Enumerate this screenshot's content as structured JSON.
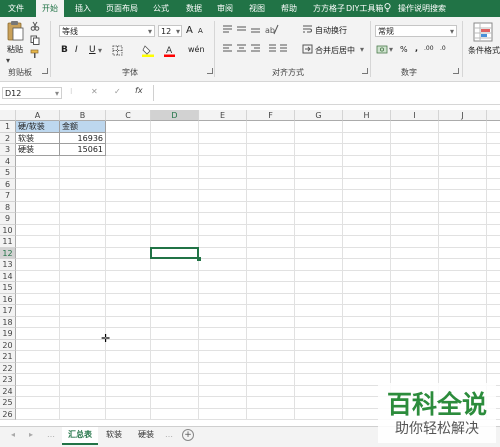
{
  "ribbon_tabs": [
    "文件",
    "开始",
    "插入",
    "页面布局",
    "公式",
    "数据",
    "审阅",
    "视图",
    "帮助",
    "方方格子",
    "DIY工具箱",
    "操作说明搜索"
  ],
  "active_tab": "开始",
  "clipboard": {
    "paste_label": "粘贴",
    "group_label": "剪贴板"
  },
  "font": {
    "name": "等线",
    "size": "12",
    "group_label": "字体",
    "grow_label": "A",
    "shrink_label": "A",
    "bold": "B",
    "italic": "I",
    "underline": "U",
    "wen": "wén"
  },
  "alignment": {
    "wrap_label": "自动换行",
    "merge_label": "合并后居中",
    "group_label": "对齐方式"
  },
  "number": {
    "format": "常规",
    "percent": "%",
    "comma": ",",
    "group_label": "数字",
    "dec_inc": ".00",
    "dec_dec": ".0"
  },
  "styles": {
    "cond_label": "条件格式"
  },
  "formula_bar": {
    "name_box": "D12",
    "fx": "fx",
    "formula": ""
  },
  "columns": [
    "A",
    "B",
    "C",
    "D",
    "E",
    "F",
    "G",
    "H",
    "I",
    "J",
    "K"
  ],
  "rows": [
    "1",
    "2",
    "3",
    "4",
    "5",
    "6",
    "7",
    "8",
    "9",
    "10",
    "11",
    "12",
    "13",
    "14",
    "15",
    "16",
    "17",
    "18",
    "19",
    "20",
    "21",
    "22",
    "23",
    "24",
    "25",
    "26"
  ],
  "cells": {
    "A1": "硬/软装",
    "B1": "金额",
    "A2": "软装",
    "B2": "16936",
    "A3": "硬装",
    "B3": "15061"
  },
  "selected_cell": "D12",
  "sheets": [
    "汇总表",
    "软装",
    "硬装"
  ],
  "active_sheet": "汇总表",
  "watermark": {
    "line1": "百科全说",
    "line2": "助你轻松解决"
  },
  "colors": {
    "excel_green": "#217346",
    "header_fill": "#bdd7ee",
    "watermark_green": "#2c8c3c"
  }
}
